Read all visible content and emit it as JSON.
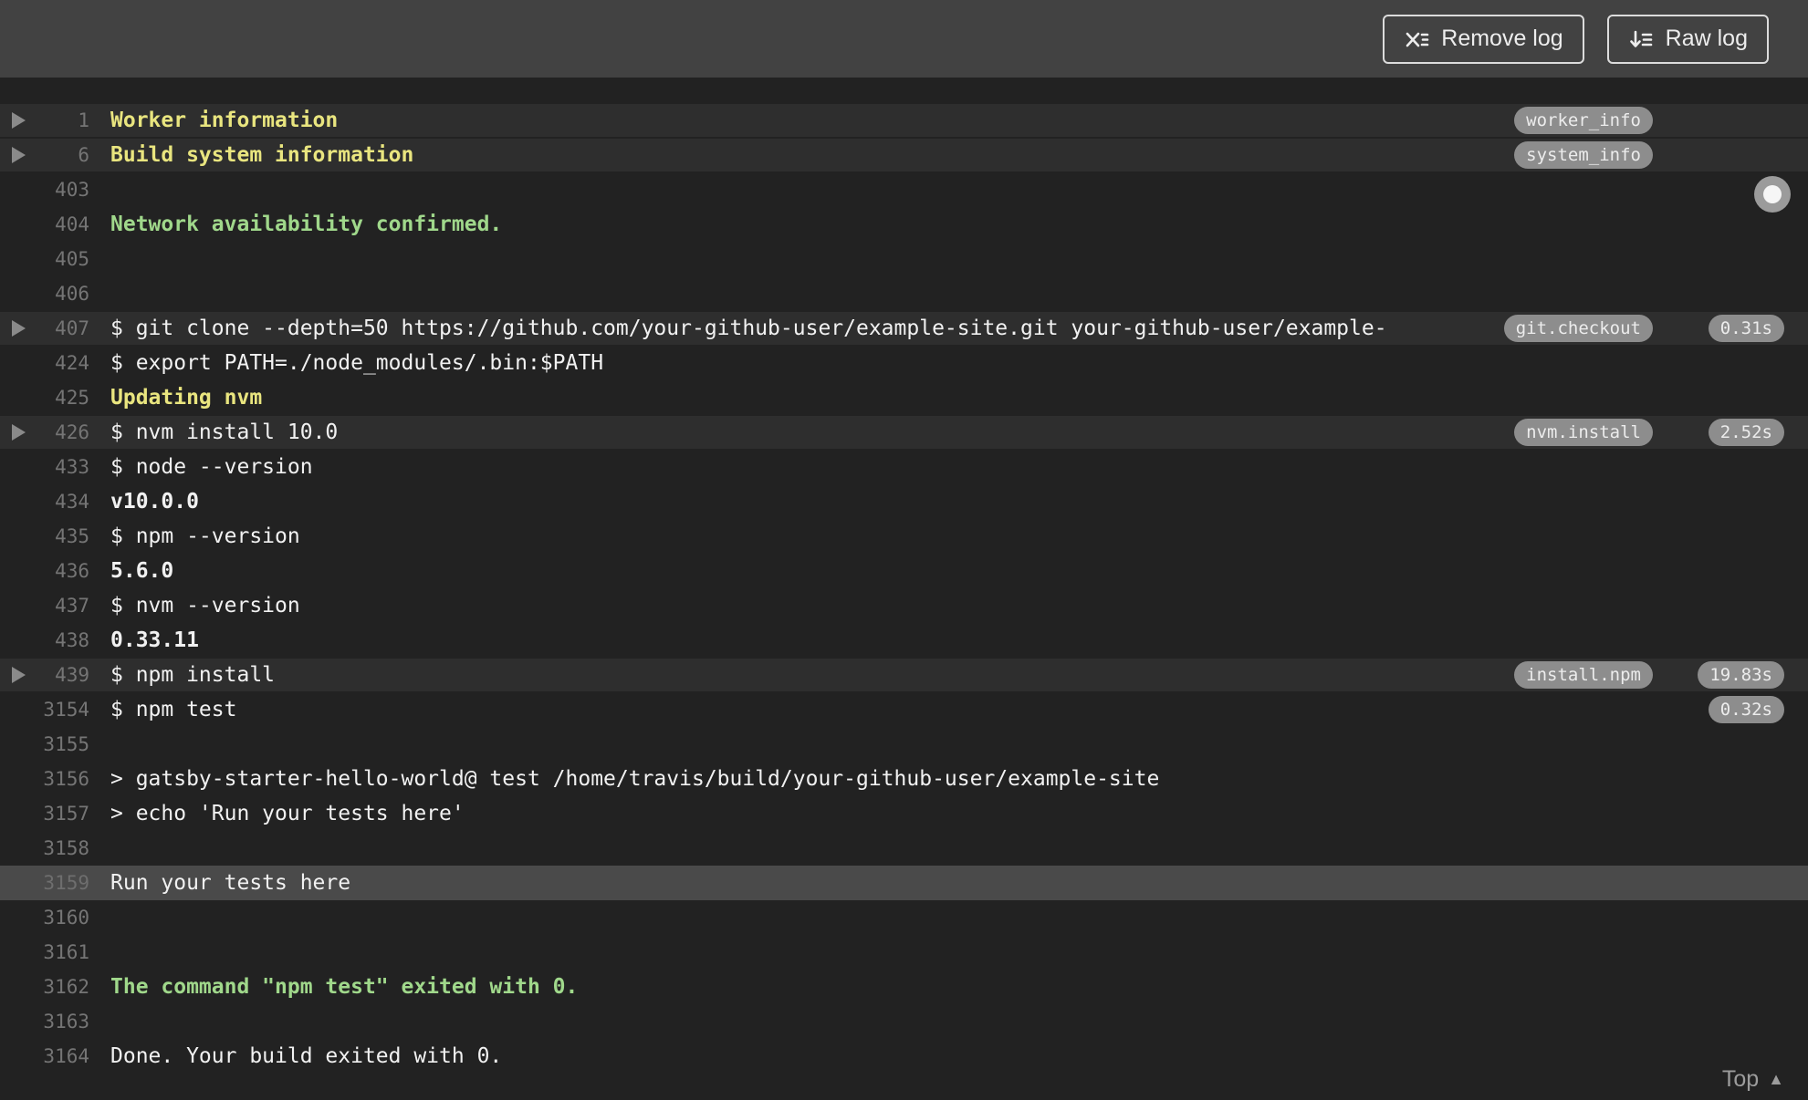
{
  "header": {
    "buttons": [
      {
        "label": "Remove log",
        "icon": "x-list"
      },
      {
        "label": "Raw log",
        "icon": "arrow-down-list"
      }
    ]
  },
  "log": {
    "lines": [
      {
        "num": "1",
        "text": "Worker information",
        "style": "yellow",
        "fold": true,
        "highlight": true,
        "badge": "worker_info"
      },
      {
        "num": "6",
        "text": "Build system information",
        "style": "yellow",
        "fold": true,
        "highlight": true,
        "badge": "system_info"
      },
      {
        "num": "403",
        "text": ""
      },
      {
        "num": "404",
        "text": "Network availability confirmed.",
        "style": "green"
      },
      {
        "num": "405",
        "text": ""
      },
      {
        "num": "406",
        "text": ""
      },
      {
        "num": "407",
        "text": "$ git clone --depth=50 https://github.com/your-github-user/example-site.git your-github-user/example-",
        "fold": true,
        "highlight": true,
        "badge": "git.checkout",
        "time": "0.31s"
      },
      {
        "num": "424",
        "text": "$ export PATH=./node_modules/.bin:$PATH"
      },
      {
        "num": "425",
        "text": "Updating nvm",
        "style": "yellow"
      },
      {
        "num": "426",
        "text": "$ nvm install 10.0",
        "fold": true,
        "highlight": true,
        "badge": "nvm.install",
        "time": "2.52s"
      },
      {
        "num": "433",
        "text": "$ node --version"
      },
      {
        "num": "434",
        "text": "v10.0.0",
        "style": "bold"
      },
      {
        "num": "435",
        "text": "$ npm --version"
      },
      {
        "num": "436",
        "text": "5.6.0",
        "style": "bold"
      },
      {
        "num": "437",
        "text": "$ nvm --version"
      },
      {
        "num": "438",
        "text": "0.33.11",
        "style": "bold"
      },
      {
        "num": "439",
        "text": "$ npm install",
        "fold": true,
        "highlight": true,
        "badge": "install.npm",
        "time": "19.83s"
      },
      {
        "num": "3154",
        "text": "$ npm test",
        "time": "0.32s"
      },
      {
        "num": "3155",
        "text": ""
      },
      {
        "num": "3156",
        "text": "> gatsby-starter-hello-world@ test /home/travis/build/your-github-user/example-site"
      },
      {
        "num": "3157",
        "text": "> echo 'Run your tests here'"
      },
      {
        "num": "3158",
        "text": ""
      },
      {
        "num": "3159",
        "text": "Run your tests here",
        "selected": true
      },
      {
        "num": "3160",
        "text": ""
      },
      {
        "num": "3161",
        "text": ""
      },
      {
        "num": "3162",
        "text": "The command \"npm test\" exited with 0.",
        "style": "green"
      },
      {
        "num": "3163",
        "text": ""
      },
      {
        "num": "3164",
        "text": "Done. Your build exited with 0."
      }
    ]
  },
  "footer": {
    "top_label": "Top",
    "top_icon": "▲"
  },
  "colors": {
    "header_bg": "#424242",
    "log_bg": "#222222",
    "fold_row_bg": "#2e2e2e",
    "selected_row_bg": "#4a4a4a",
    "yellow_text": "#e9e57f",
    "green_text": "#a0d88b",
    "log_text": "#f1f1f1",
    "line_number": "#757575",
    "badge_bg": "#8d8d8d"
  }
}
